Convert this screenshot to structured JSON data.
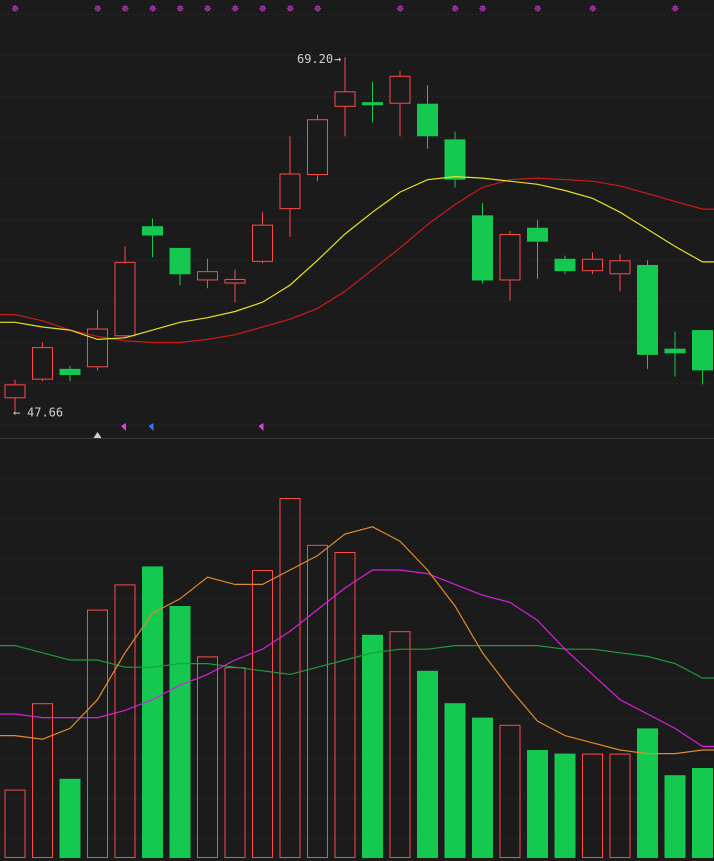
{
  "colors": {
    "background": "#1b1b1b",
    "grid": "#2f2f2f",
    "up": "#ff4a4a",
    "down": "#14c850",
    "ma_short": "#e8e028",
    "ma_long": "#cc1a1a",
    "vol_ma1": "#e08a2a",
    "vol_ma2": "#d820d8",
    "vol_ma3": "#1f9a3a",
    "marker_magenta": "#e040e0",
    "marker_blue": "#2a78ff",
    "marker_white": "#cfcfcf",
    "label": "#cfcfcf"
  },
  "labels": {
    "high_price": "69.20",
    "low_price": "47.66"
  },
  "chart_data": {
    "type": "candlestick",
    "price_range": [
      45.8,
      71.6
    ],
    "volume_range": [
      0,
      100
    ],
    "candles": [
      {
        "o": 48.1,
        "c": 47.2,
        "h": 48.4,
        "l": 46.4,
        "v": 19,
        "dir": "up"
      },
      {
        "o": 48.4,
        "c": 50.5,
        "h": 50.8,
        "l": 48.3,
        "v": 43,
        "dir": "up"
      },
      {
        "o": 49.1,
        "c": 48.7,
        "h": 49.3,
        "l": 48.3,
        "v": 22,
        "dir": "down"
      },
      {
        "o": 49.2,
        "c": 51.7,
        "h": 52.9,
        "l": 49.0,
        "v": 69,
        "dir": "up"
      },
      {
        "o": 51.2,
        "c": 56.0,
        "h": 57.0,
        "l": 51.1,
        "v": 76,
        "dir": "up"
      },
      {
        "o": 57.7,
        "c": 58.3,
        "h": 58.8,
        "l": 56.3,
        "v": 81,
        "dir": "down"
      },
      {
        "o": 56.9,
        "c": 55.2,
        "h": 56.1,
        "l": 54.5,
        "v": 70,
        "dir": "down"
      },
      {
        "o": 54.8,
        "c": 55.4,
        "h": 56.2,
        "l": 54.3,
        "v": 56,
        "dir": "up"
      },
      {
        "o": 54.6,
        "c": 54.9,
        "h": 55.5,
        "l": 53.4,
        "v": 53,
        "dir": "up"
      },
      {
        "o": 56.0,
        "c": 58.4,
        "h": 59.2,
        "l": 55.9,
        "v": 80,
        "dir": "up"
      },
      {
        "o": 59.4,
        "c": 61.7,
        "h": 64.1,
        "l": 57.6,
        "v": 100,
        "dir": "up"
      },
      {
        "o": 61.6,
        "c": 65.2,
        "h": 65.5,
        "l": 61.2,
        "v": 87,
        "dir": "up"
      },
      {
        "o": 67.0,
        "c": 66.0,
        "h": 69.2,
        "l": 64.1,
        "v": 85,
        "dir": "up"
      },
      {
        "o": 66.3,
        "c": 66.1,
        "h": 67.6,
        "l": 65.0,
        "v": 62,
        "dir": "down"
      },
      {
        "o": 66.2,
        "c": 68.0,
        "h": 68.3,
        "l": 64.1,
        "v": 63,
        "dir": "up"
      },
      {
        "o": 66.2,
        "c": 64.1,
        "h": 67.4,
        "l": 63.3,
        "v": 52,
        "dir": "down"
      },
      {
        "o": 63.9,
        "c": 61.3,
        "h": 64.4,
        "l": 60.8,
        "v": 43,
        "dir": "down"
      },
      {
        "o": 59.0,
        "c": 54.8,
        "h": 59.8,
        "l": 54.6,
        "v": 39,
        "dir": "down"
      },
      {
        "o": 54.8,
        "c": 57.8,
        "h": 58.0,
        "l": 53.5,
        "v": 37,
        "dir": "up"
      },
      {
        "o": 58.2,
        "c": 57.3,
        "h": 58.7,
        "l": 54.9,
        "v": 30,
        "dir": "down"
      },
      {
        "o": 56.2,
        "c": 55.4,
        "h": 56.4,
        "l": 55.2,
        "v": 29,
        "dir": "down"
      },
      {
        "o": 55.4,
        "c": 56.2,
        "h": 56.6,
        "l": 55.2,
        "v": 29,
        "dir": "up"
      },
      {
        "o": 55.2,
        "c": 56.1,
        "h": 56.5,
        "l": 54.1,
        "v": 29,
        "dir": "up"
      },
      {
        "o": 55.8,
        "c": 50.0,
        "h": 56.1,
        "l": 49.1,
        "v": 36,
        "dir": "down"
      },
      {
        "o": 50.4,
        "c": 50.1,
        "h": 51.5,
        "l": 48.6,
        "v": 23,
        "dir": "down"
      },
      {
        "o": 51.6,
        "c": 49.0,
        "h": 51.6,
        "l": 48.1,
        "v": 25,
        "dir": "down"
      }
    ],
    "ma_short": [
      52.1,
      51.8,
      51.6,
      51.0,
      51.1,
      51.6,
      52.1,
      52.4,
      52.8,
      53.4,
      54.5,
      56.1,
      57.8,
      59.2,
      60.5,
      61.3,
      61.5,
      61.4,
      61.2,
      61.0,
      60.6,
      60.1,
      59.2,
      58.1,
      57.0,
      56.0
    ],
    "ma_long": [
      52.6,
      52.2,
      51.6,
      51.2,
      50.9,
      50.8,
      50.8,
      51.0,
      51.3,
      51.8,
      52.3,
      53.0,
      54.1,
      55.5,
      56.9,
      58.4,
      59.7,
      60.8,
      61.3,
      61.4,
      61.3,
      61.2,
      60.9,
      60.4,
      59.9,
      59.4
    ],
    "vol_ma1": [
      34,
      33,
      36,
      44,
      57,
      68,
      72,
      78,
      76,
      76,
      80,
      84,
      90,
      92,
      88,
      80,
      70,
      57,
      47,
      38,
      34,
      32,
      30,
      29,
      29,
      30
    ],
    "vol_ma2": [
      40,
      39,
      39,
      39,
      41,
      44,
      48,
      51,
      55,
      58,
      63,
      69,
      75,
      80,
      80,
      79,
      76,
      73,
      71,
      66,
      58,
      51,
      44,
      40,
      36,
      31
    ],
    "vol_ma3": [
      59,
      57,
      55,
      55,
      53,
      53,
      54,
      54,
      53,
      52,
      51,
      53,
      55,
      57,
      58,
      58,
      59,
      59,
      59,
      59,
      58,
      58,
      57,
      56,
      54,
      50
    ],
    "signals_top": [
      0,
      3,
      4,
      5,
      6,
      7,
      8,
      9,
      10,
      11,
      14,
      16,
      17,
      19,
      21,
      24
    ],
    "signals_bottom": [
      {
        "i": 3,
        "type": "up-triangle",
        "color": "marker_white"
      },
      {
        "i": 4,
        "type": "flag",
        "color": "marker_magenta"
      },
      {
        "i": 5,
        "type": "flag",
        "color": "marker_blue"
      },
      {
        "i": 9,
        "type": "flag",
        "color": "marker_magenta"
      }
    ],
    "high_index": 12,
    "low_index": 0
  }
}
